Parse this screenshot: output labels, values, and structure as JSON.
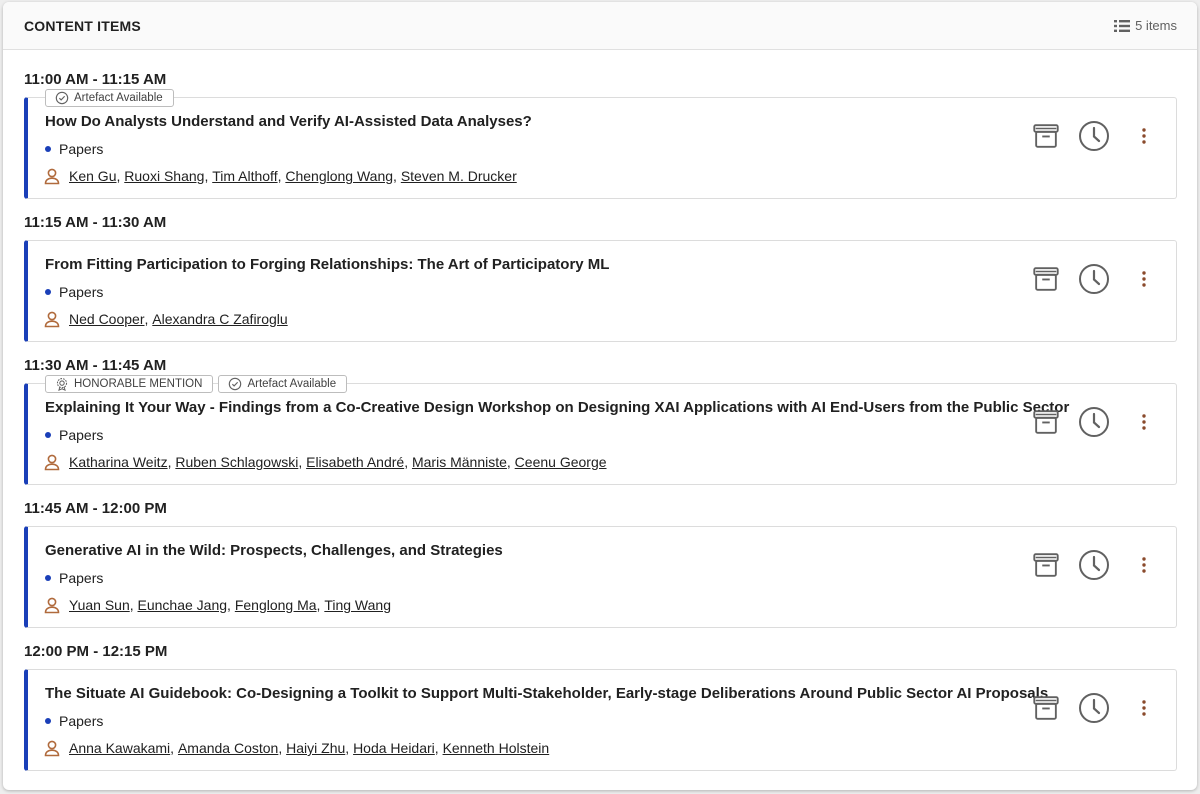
{
  "header": {
    "title": "CONTENT ITEMS",
    "count_label": "5 items",
    "icon": "list-icon"
  },
  "colors": {
    "accent": "#1a3fb8",
    "person_icon": "#b06a3c",
    "more_icon": "#8a4a2c",
    "action_icon": "#616161"
  },
  "slots": [
    {
      "time": "11:00 AM - 11:15 AM",
      "badges": [
        {
          "label": "Artefact Available",
          "icon": "check-circle-icon"
        }
      ],
      "title": "How Do Analysts Understand and Verify AI-Assisted Data Analyses?",
      "type": "Papers",
      "authors": [
        "Ken Gu",
        "Ruoxi Shang",
        "Tim Althoff",
        "Chenglong Wang",
        "Steven M. Drucker"
      ]
    },
    {
      "time": "11:15 AM - 11:30 AM",
      "badges": [],
      "title": "From Fitting Participation to Forging Relationships: The Art of Participatory ML",
      "type": "Papers",
      "authors": [
        "Ned Cooper",
        "Alexandra C Zafiroglu"
      ]
    },
    {
      "time": "11:30 AM - 11:45 AM",
      "badges": [
        {
          "label": "HONORABLE MENTION",
          "icon": "award-icon"
        },
        {
          "label": "Artefact Available",
          "icon": "check-circle-icon"
        }
      ],
      "title": "Explaining It Your Way - Findings from a Co-Creative Design Workshop on Designing XAI Applications with AI End-Users from the Public Sector",
      "type": "Papers",
      "authors": [
        "Katharina Weitz",
        "Ruben Schlagowski",
        "Elisabeth André",
        "Maris Männiste",
        "Ceenu George"
      ]
    },
    {
      "time": "11:45 AM - 12:00 PM",
      "badges": [],
      "title": "Generative AI in the Wild: Prospects, Challenges, and Strategies",
      "type": "Papers",
      "authors": [
        "Yuan Sun",
        "Eunchae Jang",
        "Fenglong Ma",
        "Ting Wang"
      ]
    },
    {
      "time": "12:00 PM - 12:15 PM",
      "badges": [],
      "title": "The Situate AI Guidebook: Co-Designing a Toolkit to Support Multi-Stakeholder, Early-stage Deliberations Around Public Sector AI Proposals",
      "type": "Papers",
      "authors": [
        "Anna Kawakami",
        "Amanda Coston",
        "Haiyi Zhu",
        "Hoda Heidari",
        "Kenneth Holstein"
      ]
    }
  ],
  "actions": {
    "archive_icon": "archive-icon",
    "clock_icon": "clock-icon",
    "more_icon": "more-vertical-icon"
  }
}
